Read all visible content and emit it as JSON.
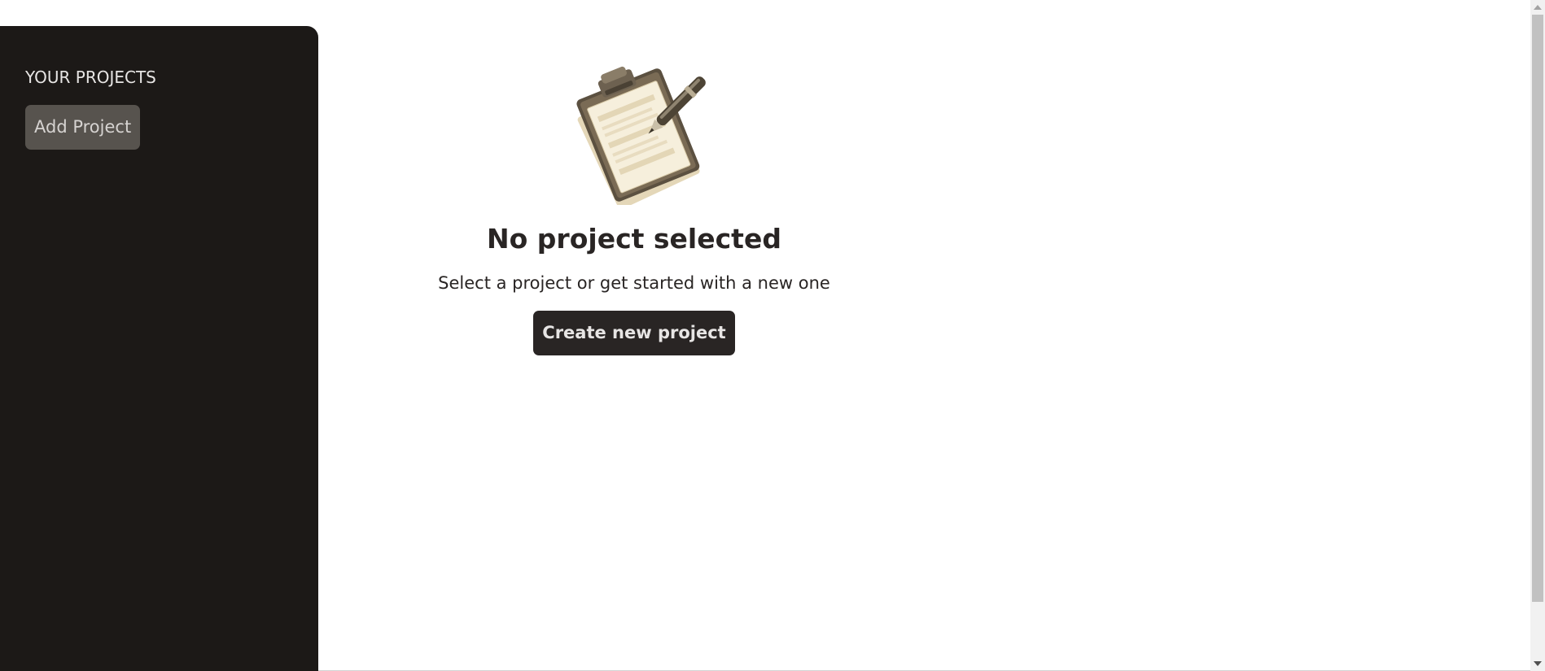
{
  "sidebar": {
    "heading": "YOUR PROJECTS",
    "add_button_label": "Add Project"
  },
  "empty_state": {
    "illustration": "clipboard-pen-icon",
    "title": "No project selected",
    "subtitle": "Select a project or get started with a new one",
    "create_button_label": "Create new project"
  },
  "colors": {
    "sidebar_bg": "#1c1917",
    "add_button_bg": "#57534e",
    "primary_button_bg": "#292524",
    "text_dark": "#292524"
  }
}
